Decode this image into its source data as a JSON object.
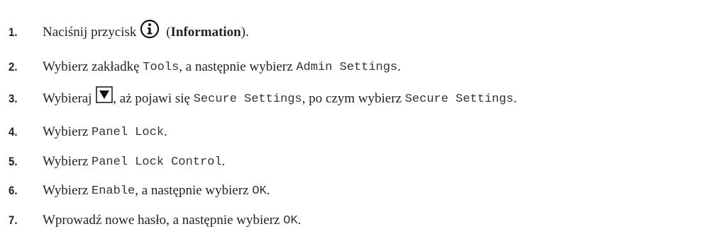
{
  "steps": [
    {
      "num": "1.",
      "pre": "Naciśnij przycisk",
      "bold": "Information",
      "paren_open": " (",
      "paren_close": ").",
      "icon": "info-icon"
    },
    {
      "num": "2.",
      "a": "Wybierz zakładkę ",
      "m1": "Tools",
      "b": ", a następnie wybierz ",
      "m2": "Admin Settings",
      "c": "."
    },
    {
      "num": "3.",
      "a": "Wybieraj ",
      "icon": "down-arrow-icon",
      "b": ", aż pojawi się ",
      "m1": "Secure Settings",
      "c": ", po czym wybierz ",
      "m2": "Secure Settings",
      "d": "."
    },
    {
      "num": "4.",
      "a": "Wybierz ",
      "m1": "Panel Lock",
      "b": "."
    },
    {
      "num": "5.",
      "a": "Wybierz ",
      "m1": "Panel Lock Control",
      "b": "."
    },
    {
      "num": "6.",
      "a": "Wybierz ",
      "m1": "Enable",
      "b": ", a następnie wybierz ",
      "m2": "OK",
      "c": "."
    },
    {
      "num": "7.",
      "a": "Wprowadź nowe hasło, a następnie wybierz ",
      "m1": "OK",
      "b": "."
    }
  ]
}
